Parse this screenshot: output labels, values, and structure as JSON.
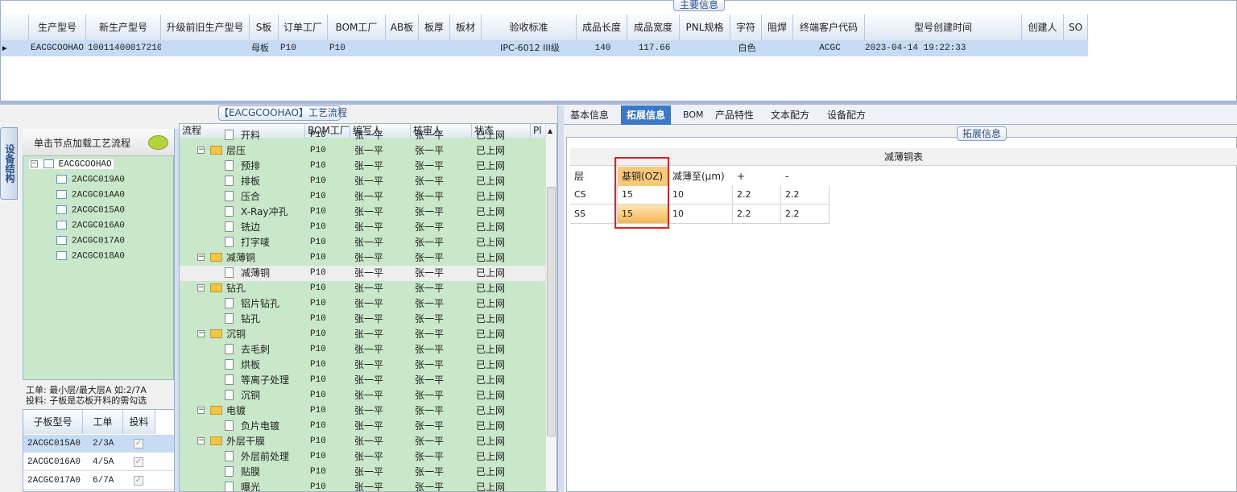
{
  "top": {
    "caption": "主要信息",
    "columns": [
      "生产型号",
      "新生产型号",
      "升级前旧生产型号",
      "S板",
      "订单工厂",
      "BOM工厂",
      "AB板",
      "板厚",
      "板材",
      "验收标准",
      "成品长度",
      "成品宽度",
      "PNL规格",
      "字符",
      "阻焊",
      "终端客户代码",
      "型号创建时间",
      "创建人",
      "SO"
    ],
    "row": {
      "c0": "EACGCOOHAO",
      "c1": "10011400017210",
      "c3": "母板",
      "c4": "P10",
      "c5": "P10",
      "c9": "IPC-6012 III级",
      "c10": "140",
      "c11": "117.66",
      "c13": "白色",
      "c15": "ACGC",
      "c16": "2023-04-14 19:22:33"
    }
  },
  "left": {
    "vtab": "设备结构",
    "load_button": "单击节点加载工艺流程",
    "tree_root": "EACGCOOHAO",
    "tree_items": [
      "2ACGC019A0",
      "2ACGC01AA0",
      "2ACGC015A0",
      "2ACGC016A0",
      "2ACGC017A0",
      "2ACGC018A0"
    ],
    "note1": "工单: 最小层/最大层A 如:2/7A",
    "note2": "投料: 子板是芯板开料的需勾选",
    "subgrid_headers": [
      "子板型号",
      "工单",
      "投料"
    ],
    "subgrid_rows": [
      {
        "model": "2ACGC015A0",
        "order": "2/3A"
      },
      {
        "model": "2ACGC016A0",
        "order": "4/5A"
      },
      {
        "model": "2ACGC017A0",
        "order": "6/7A"
      }
    ]
  },
  "flow": {
    "caption": "【EACGCOOHAO】工艺流程",
    "headers": [
      "流程",
      "BOM工厂",
      "编写人",
      "核审人",
      "状态",
      "Pl"
    ],
    "rows": [
      {
        "name": "开料",
        "bom": "P10",
        "writer": "张一平",
        "checker": "张一平",
        "status": "已上网",
        "type": "leaf"
      },
      {
        "name": "层压",
        "bom": "P10",
        "writer": "张一平",
        "checker": "张一平",
        "status": "已上网",
        "type": "folder"
      },
      {
        "name": "预排",
        "bom": "P10",
        "writer": "张一平",
        "checker": "张一平",
        "status": "已上网",
        "type": "leaf"
      },
      {
        "name": "排板",
        "bom": "P10",
        "writer": "张一平",
        "checker": "张一平",
        "status": "已上网",
        "type": "leaf"
      },
      {
        "name": "压合",
        "bom": "P10",
        "writer": "张一平",
        "checker": "张一平",
        "status": "已上网",
        "type": "leaf"
      },
      {
        "name": "X-Ray冲孔",
        "bom": "P10",
        "writer": "张一平",
        "checker": "张一平",
        "status": "已上网",
        "type": "leaf"
      },
      {
        "name": "铣边",
        "bom": "P10",
        "writer": "张一平",
        "checker": "张一平",
        "status": "已上网",
        "type": "leaf"
      },
      {
        "name": "打字唛",
        "bom": "P10",
        "writer": "张一平",
        "checker": "张一平",
        "status": "已上网",
        "type": "leaf"
      },
      {
        "name": "减薄铜",
        "bom": "P10",
        "writer": "张一平",
        "checker": "张一平",
        "status": "已上网",
        "type": "folder"
      },
      {
        "name": "减薄铜",
        "bom": "P10",
        "writer": "张一平",
        "checker": "张一平",
        "status": "已上网",
        "type": "leaf",
        "selected": true
      },
      {
        "name": "钻孔",
        "bom": "P10",
        "writer": "张一平",
        "checker": "张一平",
        "status": "已上网",
        "type": "folder"
      },
      {
        "name": "铝片钻孔",
        "bom": "P10",
        "writer": "张一平",
        "checker": "张一平",
        "status": "已上网",
        "type": "leaf"
      },
      {
        "name": "钻孔",
        "bom": "P10",
        "writer": "张一平",
        "checker": "张一平",
        "status": "已上网",
        "type": "leaf"
      },
      {
        "name": "沉铜",
        "bom": "P10",
        "writer": "张一平",
        "checker": "张一平",
        "status": "已上网",
        "type": "folder"
      },
      {
        "name": "去毛刺",
        "bom": "P10",
        "writer": "张一平",
        "checker": "张一平",
        "status": "已上网",
        "type": "leaf"
      },
      {
        "name": "烘板",
        "bom": "P10",
        "writer": "张一平",
        "checker": "张一平",
        "status": "已上网",
        "type": "leaf"
      },
      {
        "name": "等离子处理",
        "bom": "P10",
        "writer": "张一平",
        "checker": "张一平",
        "status": "已上网",
        "type": "leaf"
      },
      {
        "name": "沉铜",
        "bom": "P10",
        "writer": "张一平",
        "checker": "张一平",
        "status": "已上网",
        "type": "leaf"
      },
      {
        "name": "电镀",
        "bom": "P10",
        "writer": "张一平",
        "checker": "张一平",
        "status": "已上网",
        "type": "folder"
      },
      {
        "name": "负片电镀",
        "bom": "P10",
        "writer": "张一平",
        "checker": "张一平",
        "status": "已上网",
        "type": "leaf"
      },
      {
        "name": "外层干膜",
        "bom": "P10",
        "writer": "张一平",
        "checker": "张一平",
        "status": "已上网",
        "type": "folder"
      },
      {
        "name": "外层前处理",
        "bom": "P10",
        "writer": "张一平",
        "checker": "张一平",
        "status": "已上网",
        "type": "leaf"
      },
      {
        "name": "贴膜",
        "bom": "P10",
        "writer": "张一平",
        "checker": "张一平",
        "status": "已上网",
        "type": "leaf"
      },
      {
        "name": "曝光",
        "bom": "P10",
        "writer": "张一平",
        "checker": "张一平",
        "status": "已上网",
        "type": "leaf"
      }
    ]
  },
  "right": {
    "tabs": [
      "基本信息",
      "拓展信息",
      "BOM",
      "产品特性",
      "文本配方",
      "设备配方"
    ],
    "active_tab": "拓展信息",
    "caption": "拓展信息",
    "table_title": "减薄铜表",
    "table_headers": [
      "层",
      "基铜(OZ)",
      "减薄至(μm)",
      "+",
      "-"
    ],
    "table_rows": [
      [
        "CS",
        "15",
        "10",
        "2.2",
        "2.2"
      ],
      [
        "SS",
        "15",
        "10",
        "2.2",
        "2.2"
      ]
    ]
  }
}
